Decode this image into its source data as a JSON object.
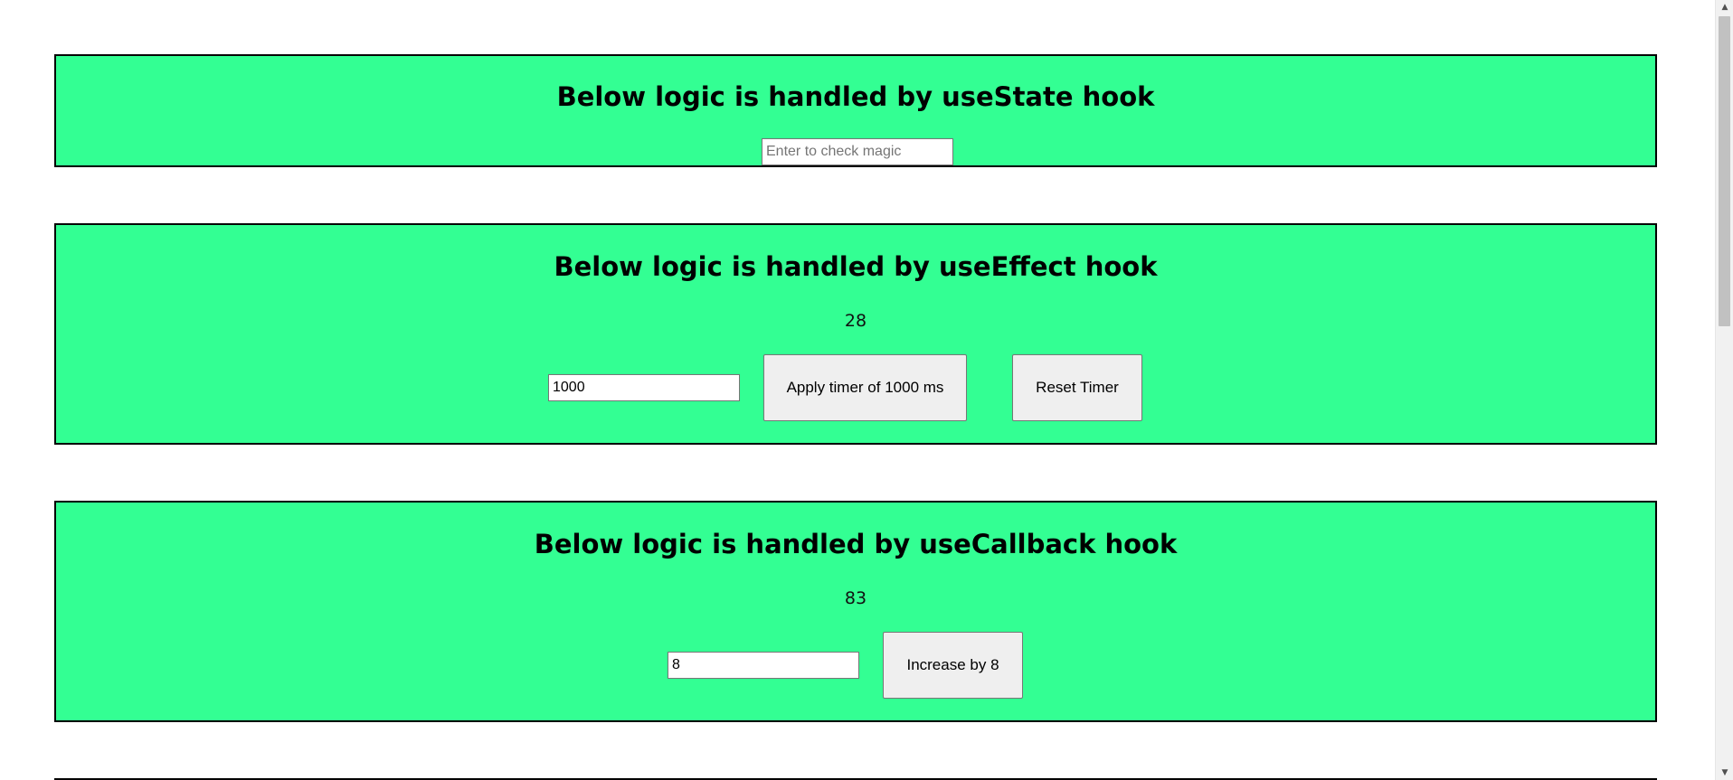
{
  "sections": [
    {
      "title": "Below logic is handled by useState hook",
      "input": {
        "value": "",
        "placeholder": "Enter to check magic"
      }
    },
    {
      "title": "Below logic is handled by useEffect hook",
      "counter": "28",
      "input": {
        "value": "1000",
        "placeholder": ""
      },
      "apply_button": "Apply timer of 1000 ms",
      "reset_button": "Reset Timer"
    },
    {
      "title": "Below logic is handled by useCallback hook",
      "counter": "83",
      "input": {
        "value": "8",
        "placeholder": ""
      },
      "increase_button": "Increase by 8"
    }
  ],
  "colors": {
    "section_background": "#33ff93",
    "border": "#000000",
    "button_background": "#efefef"
  },
  "scrollbar": {
    "up_icon": "triangle-up-icon",
    "down_icon": "triangle-down-icon"
  }
}
